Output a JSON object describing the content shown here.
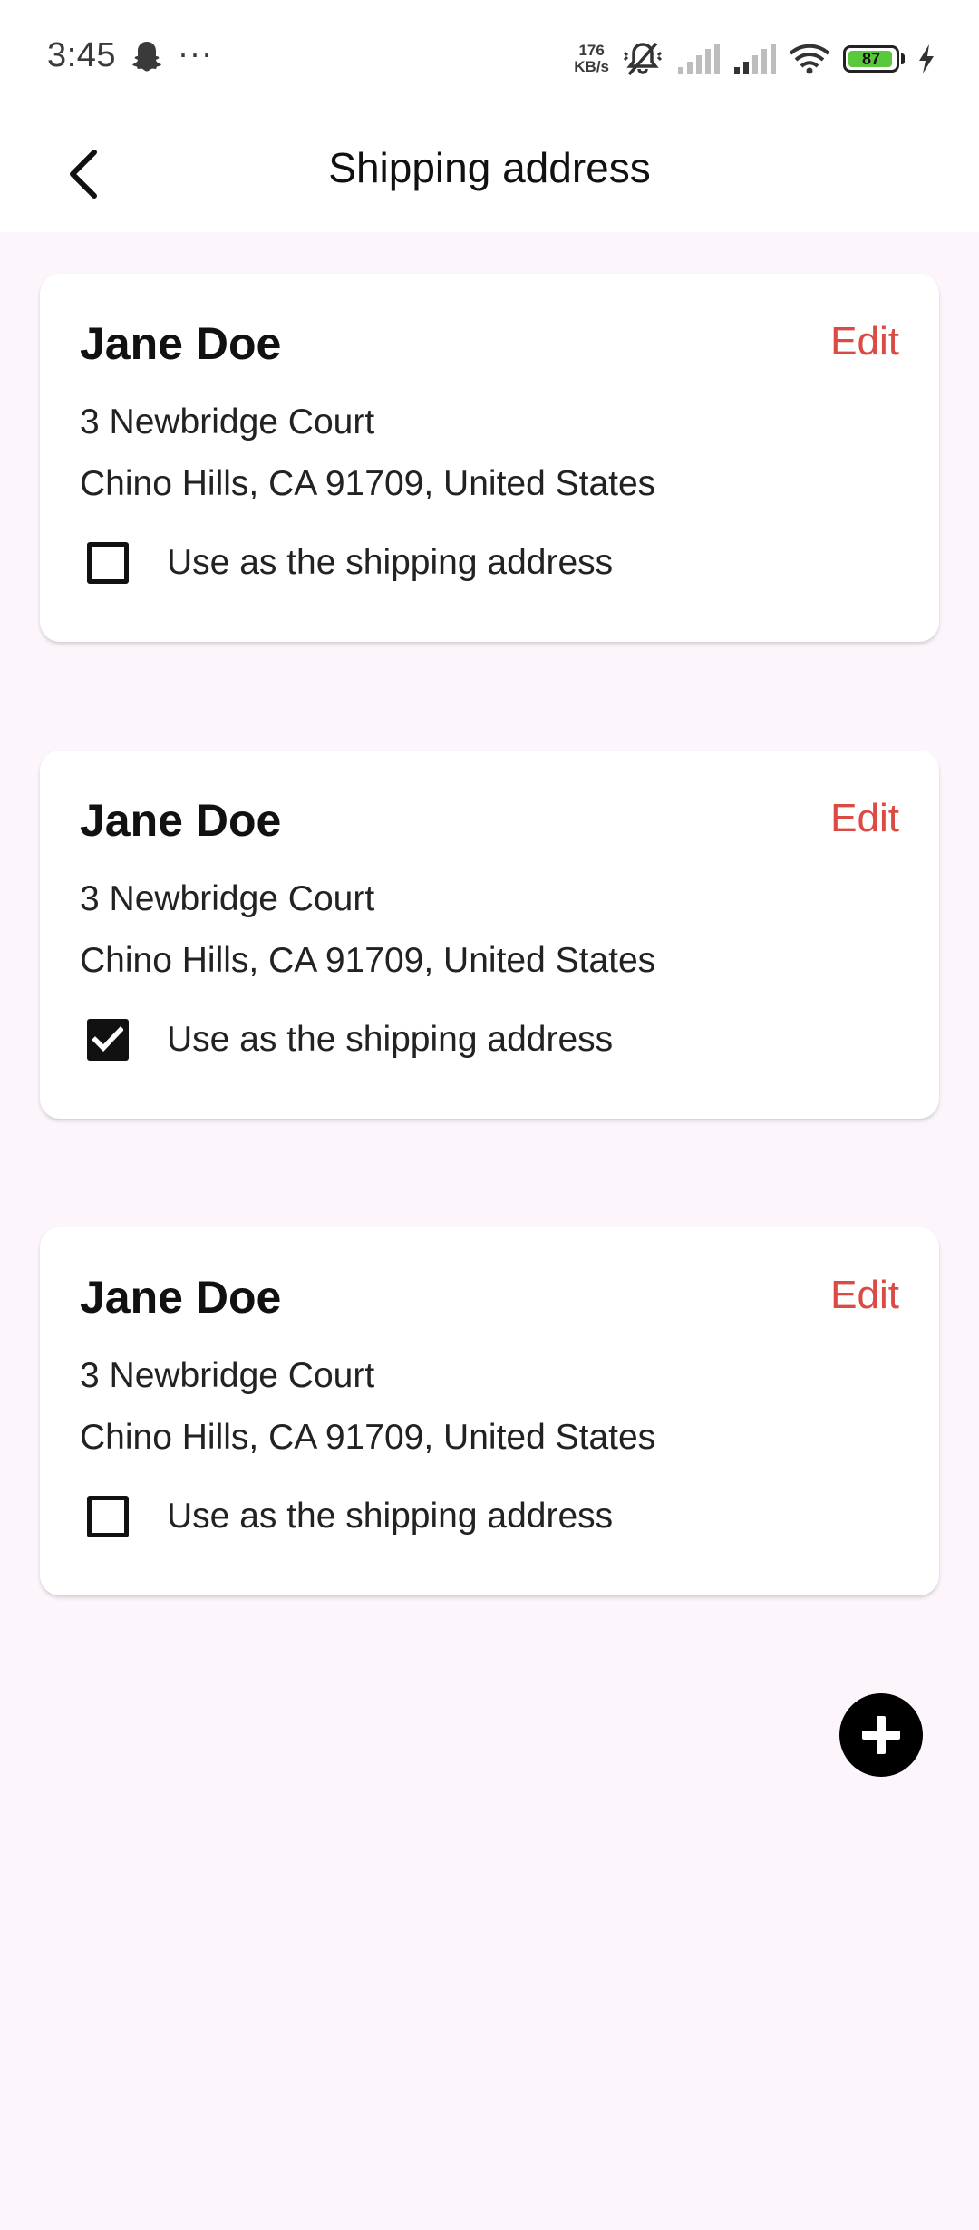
{
  "status_bar": {
    "time": "3:45",
    "more": "···",
    "speed_value": "176",
    "speed_unit": "KB/s",
    "battery": "87"
  },
  "app_bar": {
    "title": "Shipping address"
  },
  "addresses": [
    {
      "name": "Jane Doe",
      "edit_label": "Edit",
      "line1": "3 Newbridge Court",
      "line2": "Chino Hills, CA 91709, United States",
      "checkbox_label": "Use as the shipping address",
      "checked": false
    },
    {
      "name": "Jane Doe",
      "edit_label": "Edit",
      "line1": "3 Newbridge Court",
      "line2": "Chino Hills, CA 91709, United States",
      "checkbox_label": "Use as the shipping address",
      "checked": true
    },
    {
      "name": "Jane Doe",
      "edit_label": "Edit",
      "line1": "3 Newbridge Court",
      "line2": "Chino Hills, CA 91709, United States",
      "checkbox_label": "Use as the shipping address",
      "checked": false
    }
  ],
  "icons": {
    "back": "chevron-left-icon",
    "add": "plus-circle-icon",
    "check": "check-icon"
  },
  "colors": {
    "accent": "#dc4a44",
    "background": "#fcf6fc",
    "battery": "#59c83b"
  }
}
